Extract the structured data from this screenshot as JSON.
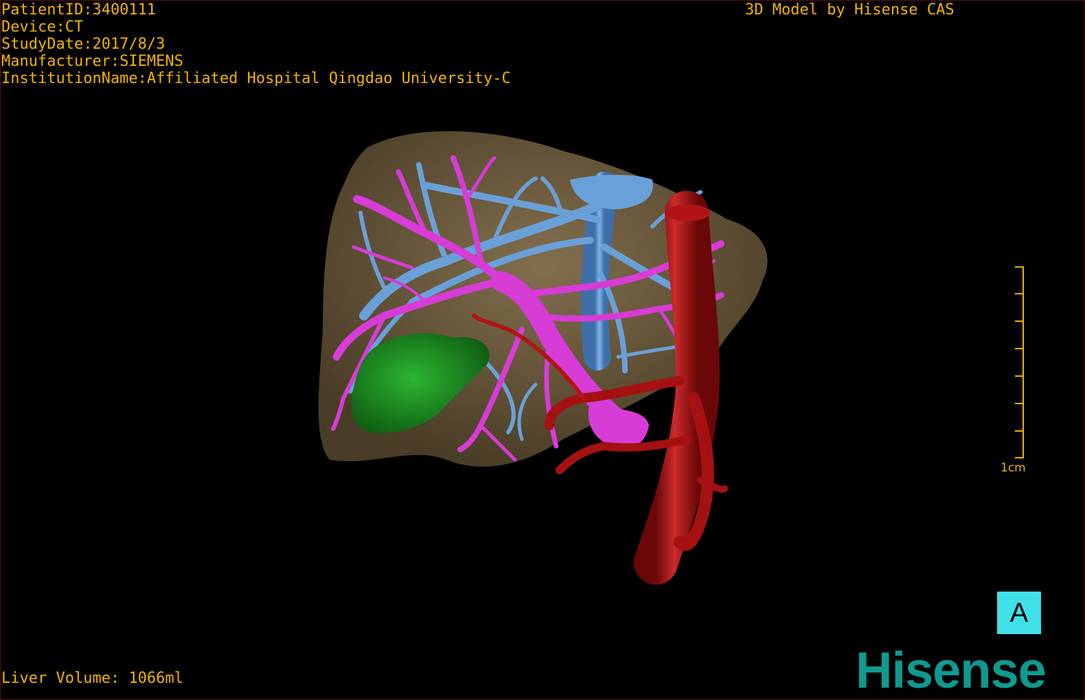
{
  "header": {
    "patient_id": "PatientID:3400111",
    "device": "Device:CT",
    "study_date": "StudyDate:2017/8/3",
    "manufacturer": "Manufacturer:SIEMENS",
    "institution": "InstitutionName:Affiliated Hospital Qingdao University-C",
    "credit": "3D Model by Hisense CAS"
  },
  "footer": {
    "liver_volume": "Liver Volume: 1066ml",
    "brand": "Hisense"
  },
  "scale_bar": {
    "label": "1cm"
  },
  "view_button": {
    "label": "A"
  },
  "colors": {
    "text": "#f2b400",
    "liver": "#6b5a3c",
    "hepatic_vein": "#6aa0d8",
    "portal_vein": "#d73cd6",
    "artery": "#b11414",
    "tumor": "#1e8f23",
    "button_bg": "#40e0e8",
    "brand": "#0f9a8f"
  }
}
